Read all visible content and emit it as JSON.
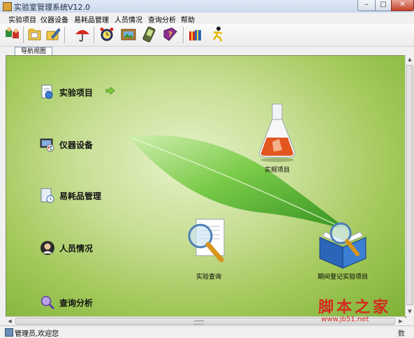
{
  "window": {
    "title": "实验室管理系统V12.0",
    "buttons": [
      "–",
      "□",
      "✕"
    ]
  },
  "menu": [
    "实验项目",
    "仪器设备",
    "易耗品管理",
    "人员情况",
    "查询分析",
    "帮助"
  ],
  "toolbar": {
    "buttons": [
      "switch-user",
      "folder-view",
      "folder-edit",
      "umbrella",
      "alarm-clock",
      "picture-frame",
      "pda",
      "help-book",
      "gift-box",
      "running-man"
    ]
  },
  "tab": {
    "label": "导航视图"
  },
  "nav": {
    "items": [
      {
        "label": "实验项目",
        "icon": "experiment-doc-icon"
      },
      {
        "label": "仪器设备",
        "icon": "monitor-icon"
      },
      {
        "label": "易耗品管理",
        "icon": "consumables-icon"
      },
      {
        "label": "人员情况",
        "icon": "person-photo-icon"
      },
      {
        "label": "查询分析",
        "icon": "magnifier-icon"
      }
    ]
  },
  "functions": {
    "items": [
      {
        "label": "实规项目",
        "icon": "flask-icon"
      },
      {
        "label": "实验查询",
        "icon": "document-search-icon"
      },
      {
        "label": "期间登记实验项目",
        "icon": "book-search-icon"
      }
    ]
  },
  "status": {
    "text": "管理员,欢迎您",
    "right": "数"
  },
  "watermark": {
    "brand": "脚本之家",
    "url": "www.jb51.net"
  },
  "colors": {
    "panel_green": "#a4c95c",
    "accent_red": "#d42a1e",
    "leaf": "#5fb52f"
  }
}
